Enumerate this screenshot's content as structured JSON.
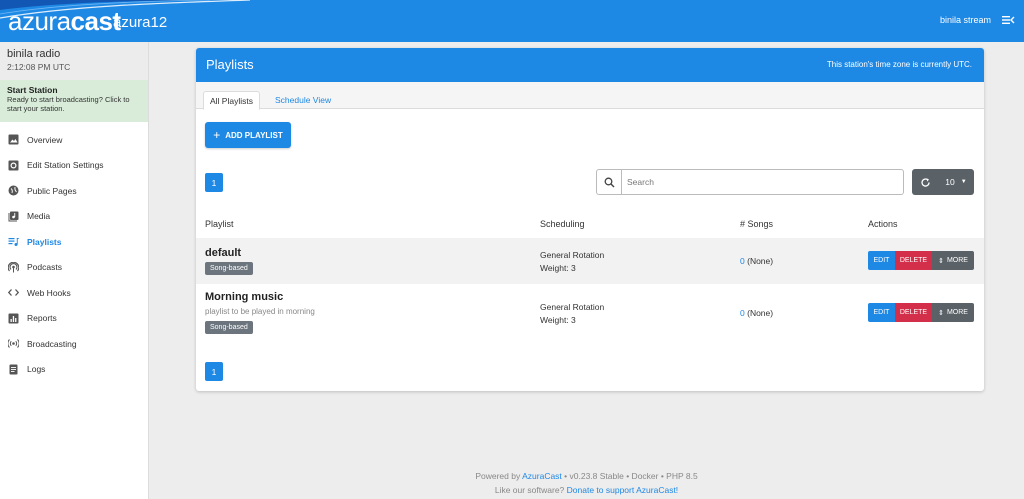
{
  "header": {
    "brand_light": "azura",
    "brand_bold": "cast",
    "station_short": "azura12",
    "user": "binila stream",
    "brand_color": "#1e88e5"
  },
  "sidebar": {
    "station_name": "binila radio",
    "station_time": "2:12:08 PM UTC",
    "start_title": "Start Station",
    "start_desc": "Ready to start broadcasting? Click to start your station.",
    "items": [
      {
        "label": "Overview",
        "icon": "image-icon"
      },
      {
        "label": "Edit Station Settings",
        "icon": "settings-box-icon"
      },
      {
        "label": "Public Pages",
        "icon": "globe-icon"
      },
      {
        "label": "Media",
        "icon": "music-library-icon"
      },
      {
        "label": "Playlists",
        "icon": "playlist-icon",
        "active": true
      },
      {
        "label": "Podcasts",
        "icon": "podcast-icon"
      },
      {
        "label": "Web Hooks",
        "icon": "code-icon"
      },
      {
        "label": "Reports",
        "icon": "chart-icon"
      },
      {
        "label": "Broadcasting",
        "icon": "broadcast-icon"
      },
      {
        "label": "Logs",
        "icon": "document-icon"
      }
    ]
  },
  "card": {
    "title": "Playlists",
    "timezone_note": "This station's time zone is currently UTC.",
    "tabs": [
      "All Playlists",
      "Schedule View"
    ],
    "add_button": "ADD PLAYLIST",
    "page_number": "1",
    "search_placeholder": "Search",
    "per_page": "10",
    "columns": [
      "Playlist",
      "Scheduling",
      "# Songs",
      "Actions"
    ],
    "rows": [
      {
        "name": "default",
        "description": "",
        "badge": "Song-based",
        "schedule": "General Rotation",
        "weight": "Weight: 3",
        "song_count": "0",
        "song_label": "(None)"
      },
      {
        "name": "Morning music",
        "description": "playlist to be played in morning",
        "badge": "Song-based",
        "schedule": "General Rotation",
        "weight": "Weight: 3",
        "song_count": "0",
        "song_label": "(None)"
      }
    ],
    "actions": {
      "edit": "EDIT",
      "delete": "DELETE",
      "more": "MORE"
    }
  },
  "footer": {
    "powered_prefix": "Powered by",
    "powered_link": "AzuraCast",
    "version_info": "• v0.23.8 Stable • Docker • PHP 8.5",
    "like_text": "Like our software?",
    "donate_link": "Donate to support AzuraCast!"
  }
}
